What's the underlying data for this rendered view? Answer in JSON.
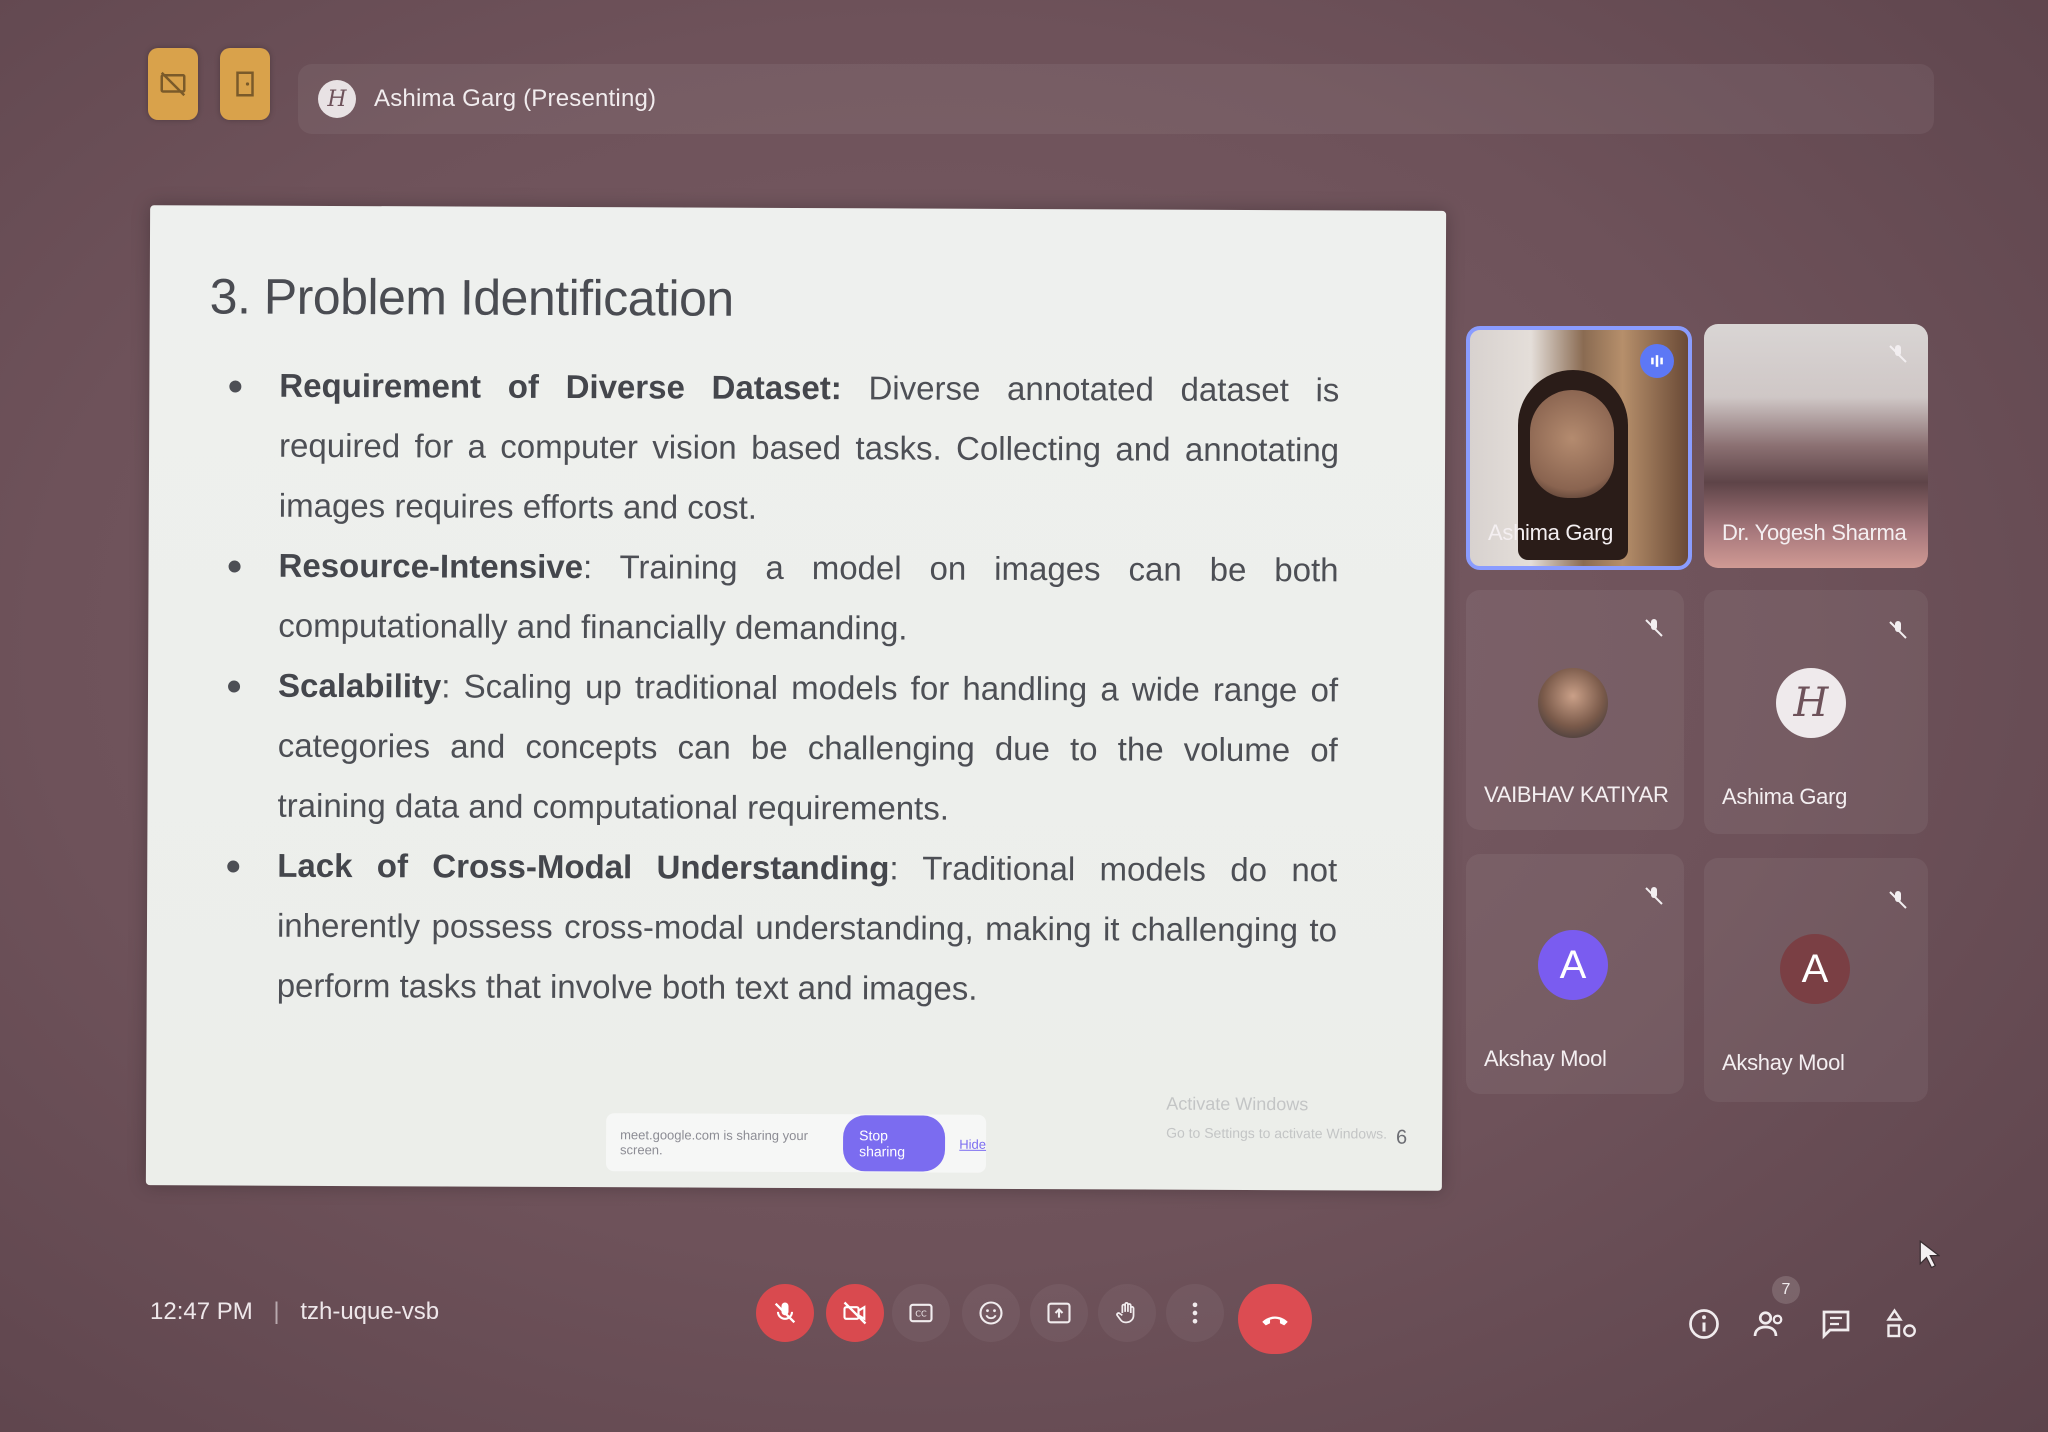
{
  "meeting": {
    "presenter_label": "Ashima Garg (Presenting)",
    "presenter_initial": "H",
    "time": "12:47 PM",
    "separator": "|",
    "meeting_code": "tzh-uque-vsb",
    "participant_count": "7"
  },
  "slide": {
    "title": "3. Problem Identification",
    "bullets": [
      {
        "bold": "Requirement of Diverse Dataset:",
        "text": " Diverse annotated dataset is required for a computer vision based tasks. Collecting and annotating images requires efforts and cost."
      },
      {
        "bold": "Resource-Intensive",
        "text": ": Training a model on images can be both computationally and financially demanding."
      },
      {
        "bold": "Scalability",
        "text": ": Scaling up traditional models for handling a wide range of categories and concepts can be challenging due to the volume of training data and computational requirements."
      },
      {
        "bold": "Lack of Cross-Modal Understanding",
        "text": ": Traditional models do not inherently possess cross-modal understanding, making it challenging to perform tasks that involve both text and images."
      }
    ],
    "share_notice": "meet.google.com is sharing your screen.",
    "stop_sharing": "Stop sharing",
    "hide": "Hide",
    "watermark_title": "Activate Windows",
    "watermark_sub": "Go to Settings to activate Windows.",
    "page_number": "6"
  },
  "participants": [
    {
      "name": "Ashima Garg",
      "type": "video"
    },
    {
      "name": "Dr. Yogesh Sharma",
      "type": "video"
    },
    {
      "name": "VAIBHAV KATIYAR",
      "type": "photo"
    },
    {
      "name": "Ashima Garg",
      "type": "logo",
      "initial": "H"
    },
    {
      "name": "Akshay Mool",
      "type": "letter",
      "initial": "A",
      "color": "#7a5cf0"
    },
    {
      "name": "Akshay Mool",
      "type": "letter",
      "initial": "A",
      "color": "#7a3f44"
    }
  ],
  "colors": {
    "top_square": "#d9a24b",
    "speaking_border": "#8a9cff",
    "end_call": "#dc4c52",
    "mic_off": "#d94a4f"
  },
  "icons": [
    "presentation-off-icon",
    "door-icon",
    "mic-off-icon",
    "camera-off-icon",
    "captions-icon",
    "emoji-icon",
    "present-icon",
    "raise-hand-icon",
    "more-options-icon",
    "end-call-icon",
    "info-icon",
    "people-icon",
    "chat-icon",
    "activities-icon"
  ]
}
